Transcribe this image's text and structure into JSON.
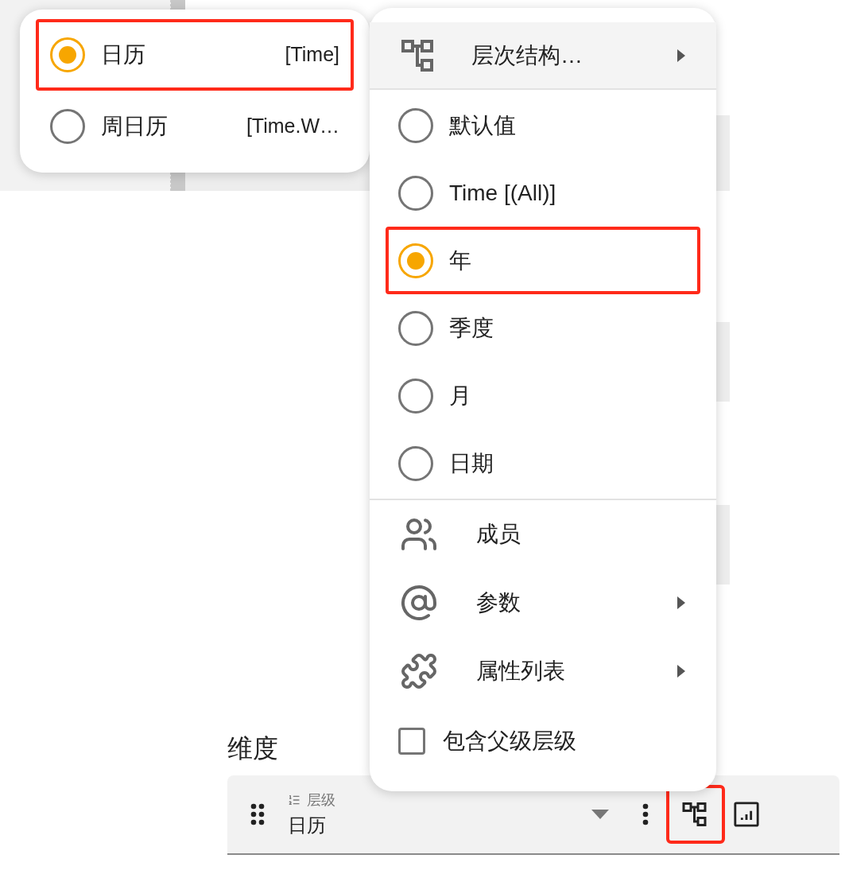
{
  "calendar_menu": {
    "items": [
      {
        "label": "日历",
        "key": "[Time]",
        "selected": true,
        "highlighted": true
      },
      {
        "label": "周日历",
        "key": "[Time.W…",
        "selected": false,
        "highlighted": false
      }
    ]
  },
  "context_menu": {
    "hierarchy": {
      "label": "层次结构…",
      "has_submenu": true
    },
    "levels": [
      {
        "label": "默认值",
        "selected": false,
        "highlighted": false
      },
      {
        "label": "Time [(All)]",
        "selected": false,
        "highlighted": false
      },
      {
        "label": "年",
        "selected": true,
        "highlighted": true
      },
      {
        "label": "季度",
        "selected": false,
        "highlighted": false
      },
      {
        "label": "月",
        "selected": false,
        "highlighted": false
      },
      {
        "label": "日期",
        "selected": false,
        "highlighted": false
      }
    ],
    "actions": [
      {
        "label": "成员",
        "kind": "members",
        "has_submenu": false
      },
      {
        "label": "参数",
        "kind": "parameter",
        "has_submenu": true
      },
      {
        "label": "属性列表",
        "kind": "properties",
        "has_submenu": true
      }
    ],
    "include_parent": {
      "label": "包含父级层级",
      "checked": false
    }
  },
  "dimension": {
    "title": "维度",
    "field": {
      "caption": "层级",
      "value": "日历"
    },
    "hierarchy_button_highlighted": true
  }
}
